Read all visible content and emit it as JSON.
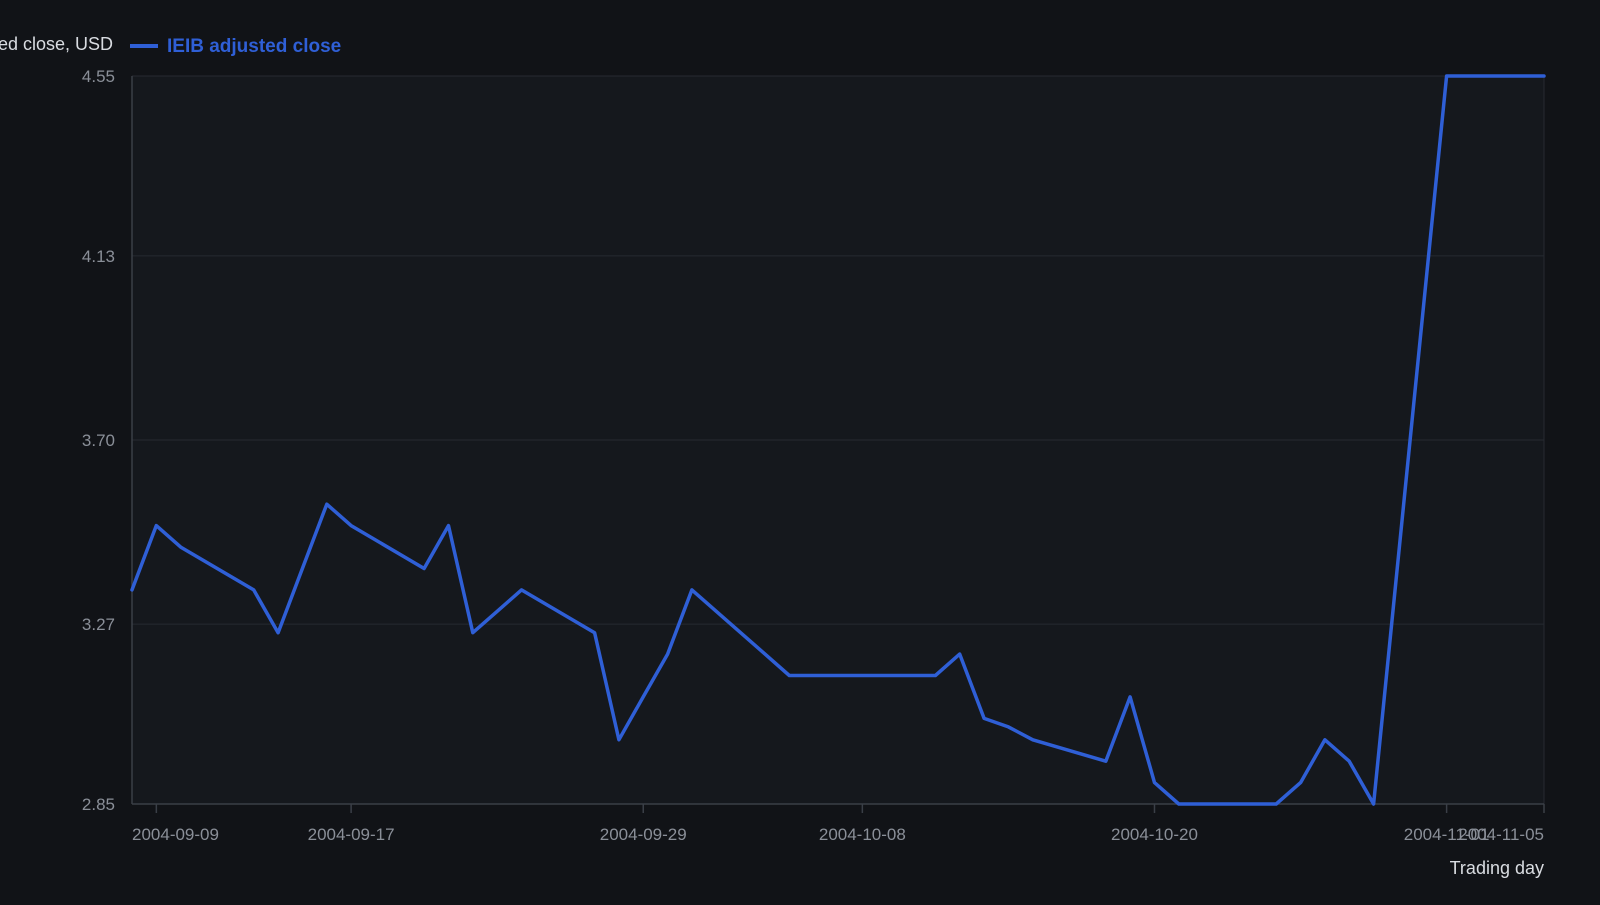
{
  "colors": {
    "background": "#111317",
    "plot_background": "#15181d",
    "series": "#2f5fd6",
    "grid": "#262a31",
    "axis": "#3a3f47",
    "tick_text": "#8a8f98",
    "label_text": "#d9dce1"
  },
  "chart_data": {
    "type": "line",
    "ylabel": "Adjusted close, USD",
    "xlabel": "Trading day",
    "legend_position": "top-left",
    "grid": true,
    "ylim": [
      2.85,
      4.55
    ],
    "yticks": [
      "2.85",
      "3.27",
      "3.70",
      "4.13",
      "4.55"
    ],
    "xticks": [
      "2004-09-09",
      "2004-09-17",
      "2004-09-29",
      "2004-10-08",
      "2004-10-20",
      "2004-11-01",
      "2004-11-05"
    ],
    "x": [
      "2004-09-08",
      "2004-09-09",
      "2004-09-10",
      "2004-09-13",
      "2004-09-14",
      "2004-09-15",
      "2004-09-16",
      "2004-09-17",
      "2004-09-20",
      "2004-09-21",
      "2004-09-22",
      "2004-09-23",
      "2004-09-24",
      "2004-09-27",
      "2004-09-28",
      "2004-09-29",
      "2004-09-30",
      "2004-10-01",
      "2004-10-04",
      "2004-10-05",
      "2004-10-06",
      "2004-10-07",
      "2004-10-08",
      "2004-10-11",
      "2004-10-12",
      "2004-10-13",
      "2004-10-14",
      "2004-10-15",
      "2004-10-18",
      "2004-10-19",
      "2004-10-20",
      "2004-10-21",
      "2004-10-22",
      "2004-10-25",
      "2004-10-26",
      "2004-10-27",
      "2004-10-28",
      "2004-10-29",
      "2004-11-01",
      "2004-11-02",
      "2004-11-03",
      "2004-11-04",
      "2004-11-05"
    ],
    "series": [
      {
        "name": "IEIB adjusted close",
        "values": [
          3.35,
          3.5,
          3.45,
          3.35,
          3.25,
          3.4,
          3.55,
          3.5,
          3.4,
          3.5,
          3.25,
          3.3,
          3.35,
          3.25,
          3.0,
          3.1,
          3.2,
          3.35,
          3.2,
          3.15,
          3.15,
          3.15,
          3.15,
          3.15,
          3.2,
          3.05,
          3.03,
          3.0,
          2.95,
          3.1,
          2.9,
          2.85,
          2.85,
          2.85,
          2.9,
          3.0,
          2.95,
          2.85,
          4.55,
          4.55,
          4.55,
          4.55,
          4.55
        ]
      }
    ]
  }
}
